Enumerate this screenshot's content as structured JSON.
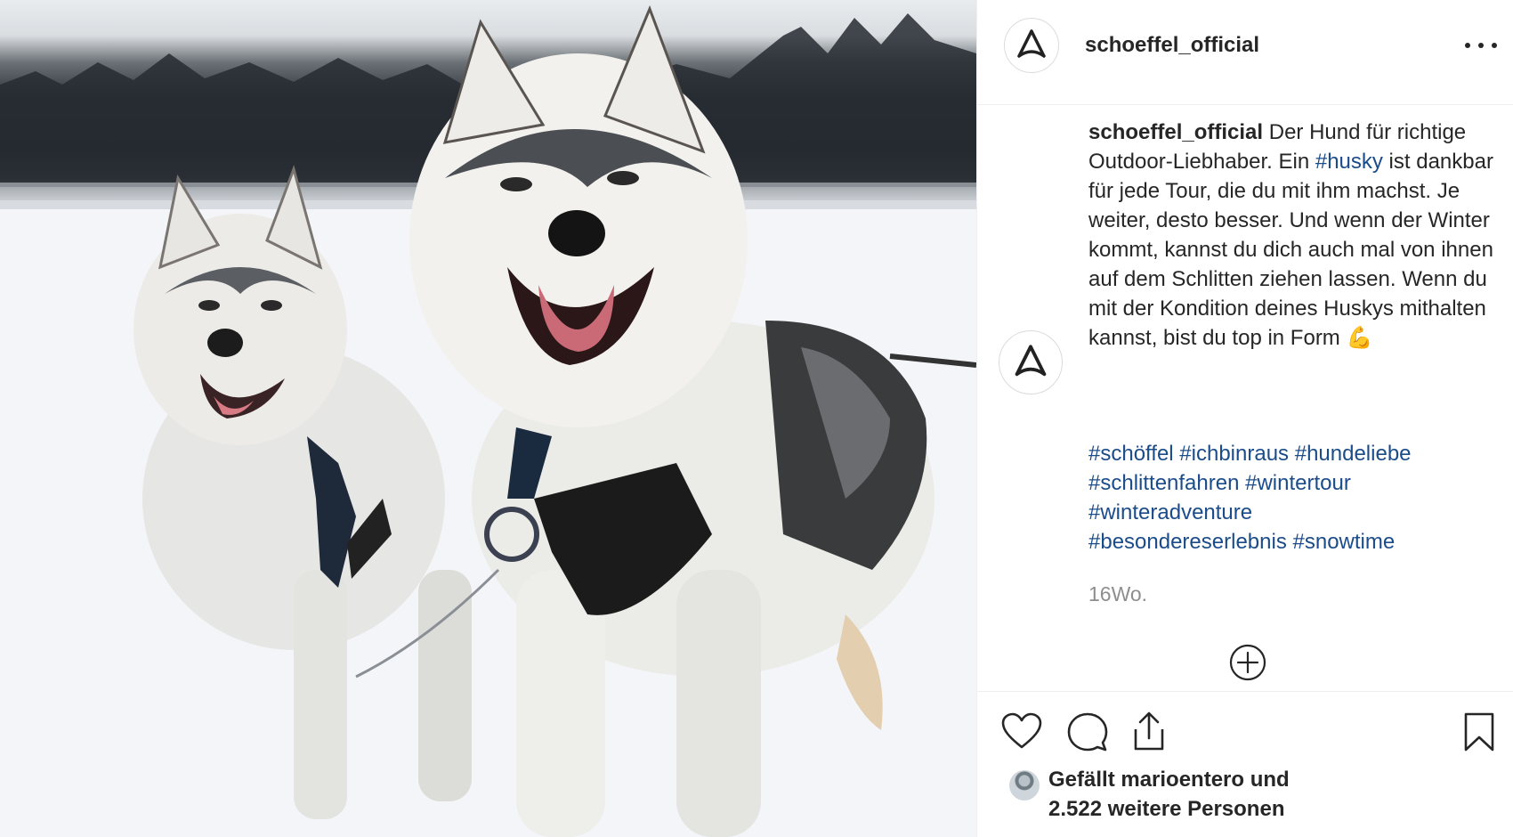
{
  "post": {
    "username": "schoeffel_official",
    "caption_text": " Der Hund für richtige Outdoor-Liebhaber. Ein ",
    "caption_tag": "#husky",
    "caption_rest": " ist dankbar für jede Tour, die du mit ihm machst. Je weiter, desto besser. Und wenn der Winter kommt, kannst du dich auch mal von ihnen auf dem Schlitten ziehen lassen. Wenn du mit der Kondition deines Huskys mithalten kannst, bist du top in Form 💪",
    "hashtags": [
      "#schöffel",
      "#ichbinraus",
      "#hundeliebe",
      "#schlittenfahren",
      "#wintertour",
      "#winteradventure",
      "#besondereserlebnis",
      "#snowtime"
    ],
    "time": "16Wo.",
    "likes_line1": "Gefällt marioentero und",
    "likes_line2": "2.522 weitere Personen"
  },
  "icons": {
    "more": "more-options-icon",
    "add": "add-circle-icon",
    "like": "heart-icon",
    "comment": "comment-icon",
    "share": "share-icon",
    "save": "bookmark-icon",
    "brand": "schoeffel-logo-icon"
  },
  "colors": {
    "text": "#262626",
    "hashtag": "#1b4c8a",
    "muted": "#8e8e8e",
    "divider": "#efefef"
  }
}
